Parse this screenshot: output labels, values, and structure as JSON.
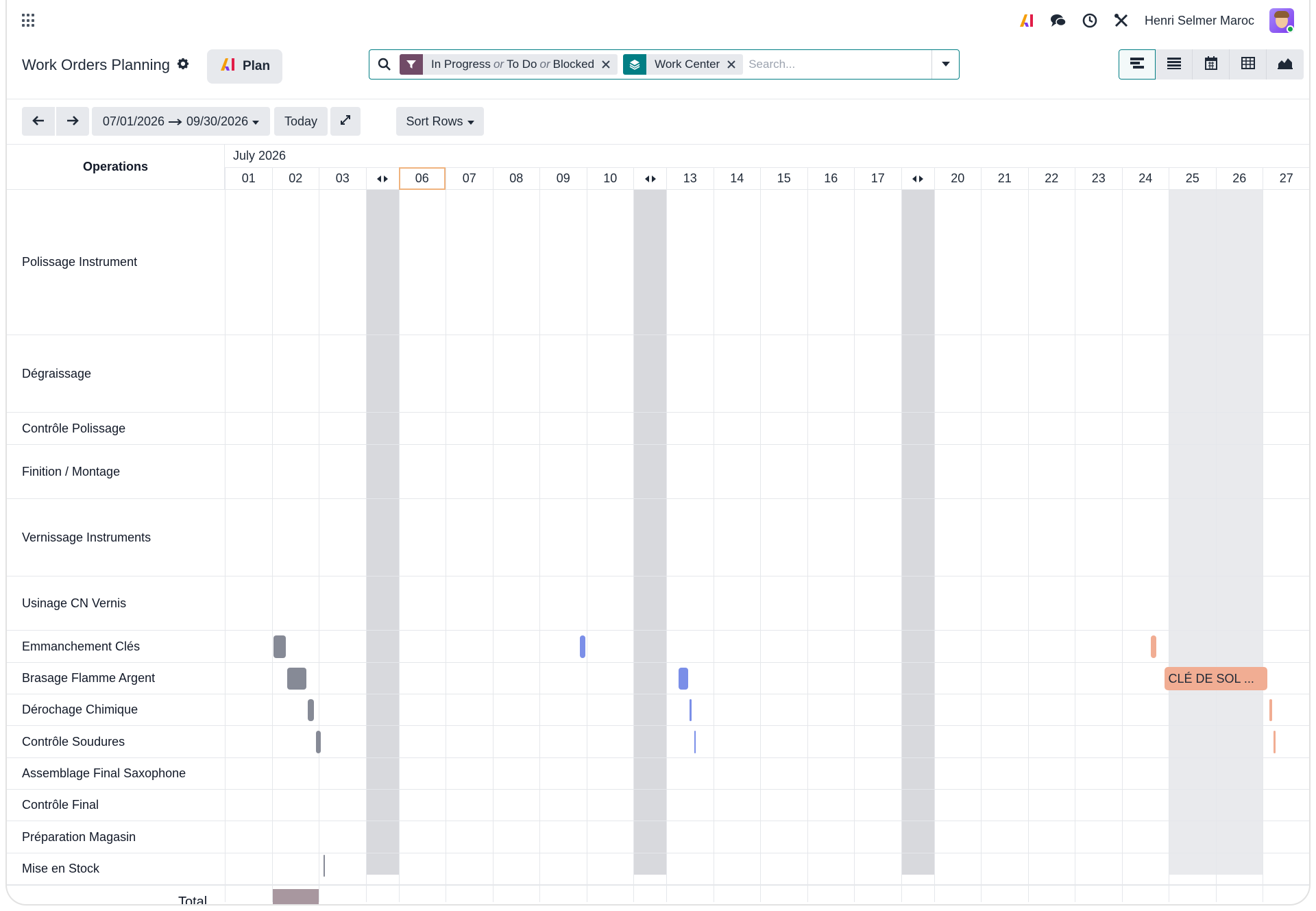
{
  "navbar": {
    "user_name": "Henri Selmer Maroc"
  },
  "control_panel": {
    "title": "Work Orders Planning",
    "plan_label": "Plan",
    "search": {
      "facets": [
        {
          "values": [
            "In Progress",
            "To Do",
            "Blocked"
          ],
          "separator": "or",
          "color": "#714b67"
        },
        {
          "values": [
            "Work Center"
          ],
          "color": "#017e84"
        }
      ],
      "placeholder": "Search..."
    },
    "views": [
      "gantt-icon",
      "list-icon",
      "calendar-icon",
      "pivot-icon",
      "graph-icon"
    ]
  },
  "toolbar": {
    "date_from": "07/01/2026",
    "date_to": "09/30/2026",
    "today_label": "Today",
    "sort_label": "Sort Rows"
  },
  "gantt": {
    "ops_header": "Operations",
    "month": "July 2026",
    "days": [
      "01",
      "02",
      "03",
      "<>",
      "06",
      "07",
      "08",
      "09",
      "10",
      "<>",
      "13",
      "14",
      "15",
      "16",
      "17",
      "<>",
      "20",
      "21",
      "22",
      "23",
      "24",
      "25",
      "26",
      "27"
    ],
    "today": "06",
    "rows": [
      "Polissage Instrument",
      "Dégraissage",
      "Contrôle Polissage",
      "Finition / Montage",
      "Vernissage Instruments",
      "Usinage CN Vernis",
      "Emmanchement Clés",
      "Brasage Flamme Argent",
      "Dérochage Chimique",
      "Contrôle Soudures",
      "Assemblage Final Saxophone",
      "Contrôle Final",
      "Préparation Magasin",
      "Mise en Stock"
    ],
    "pill_label": "CLÉ DE SOL ...",
    "total_label": "Total",
    "colors": {
      "grey": "#868a96",
      "blue": "#7b8fe8",
      "salmon": "#f1ad93",
      "total": "#a8979f"
    }
  }
}
